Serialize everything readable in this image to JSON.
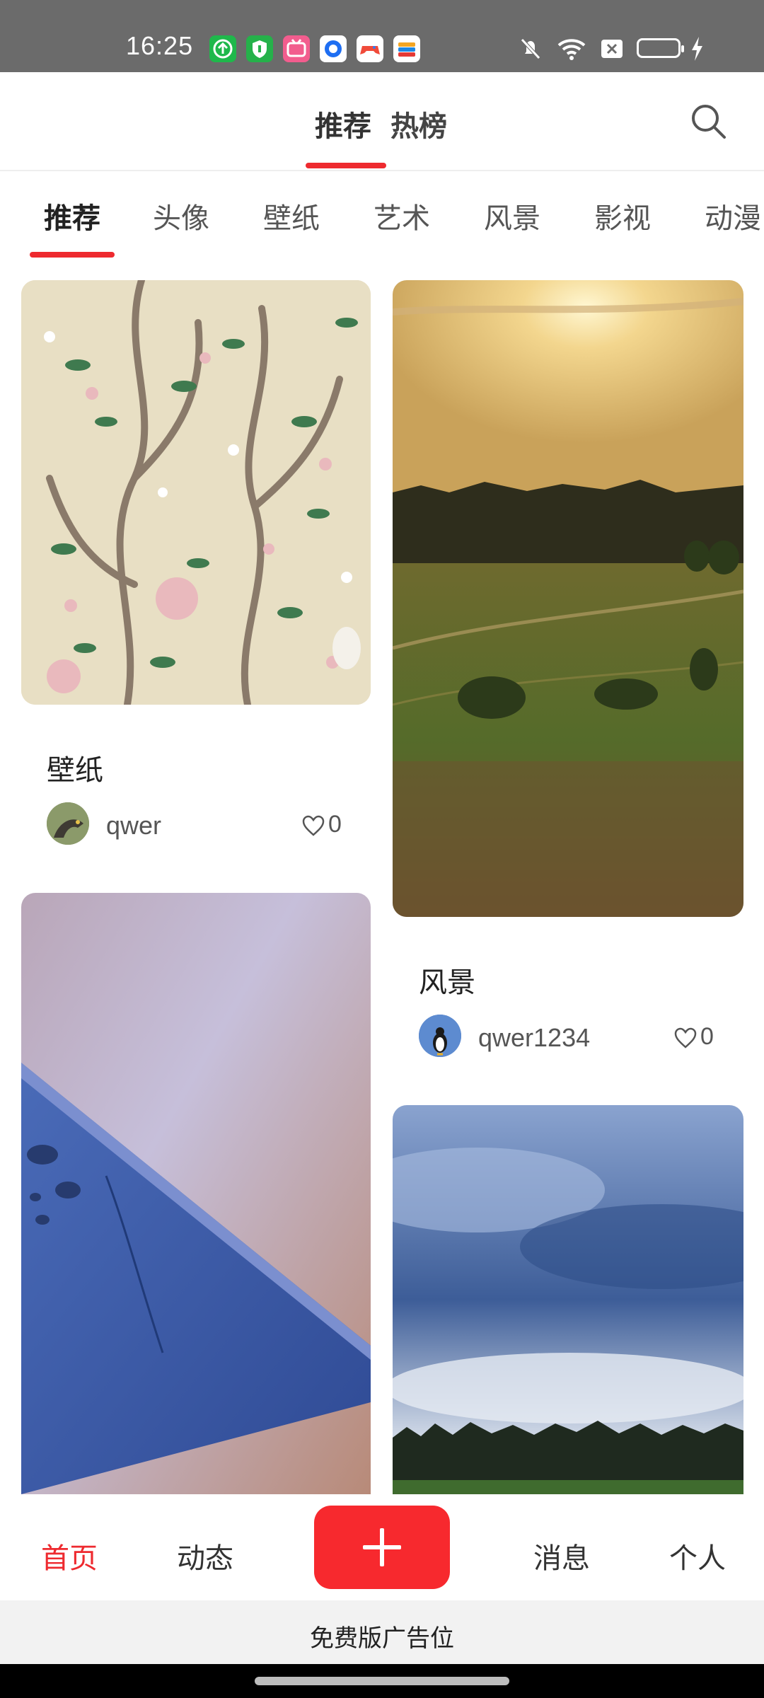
{
  "status_bar": {
    "time": "16:25",
    "app_icons": [
      "green-upload-icon",
      "green-shield-icon",
      "bilibili-icon",
      "blue-circle-app-icon",
      "game-controller-icon",
      "wallet-app-icon"
    ],
    "system_icons": [
      "mute-bell-icon",
      "wifi-icon",
      "sim-off-icon",
      "battery-icon",
      "charging-icon"
    ]
  },
  "header": {
    "tabs": [
      {
        "label": "推荐",
        "active": true
      },
      {
        "label": "热榜",
        "active": false
      }
    ],
    "search_icon": "search-icon"
  },
  "categories": {
    "items": [
      "推荐",
      "头像",
      "壁纸",
      "艺术",
      "风景",
      "影视",
      "动漫"
    ],
    "active_index": 0
  },
  "feed": {
    "left": [
      {
        "title": "壁纸",
        "user": "qwer",
        "likes": "0",
        "image": "floral-chinoiserie-wallpaper"
      },
      {
        "title": "",
        "user": "",
        "likes": "",
        "image": "blue-slate-water-droplets"
      }
    ],
    "right": [
      {
        "title": "风景",
        "user": "qwer1234",
        "likes": "0",
        "image": "sunset-field-landscape"
      },
      {
        "title": "",
        "user": "",
        "likes": "",
        "image": "cloudy-sky-treeline"
      }
    ]
  },
  "bottom_nav": {
    "items": [
      {
        "label": "首页",
        "active": true
      },
      {
        "label": "动态",
        "active": false
      },
      {
        "label": "消息",
        "active": false
      },
      {
        "label": "个人",
        "active": false
      }
    ],
    "fab_icon": "plus-icon"
  },
  "ad_bar": {
    "text": "免费版广告位"
  },
  "colors": {
    "accent": "#ee2a2f",
    "fab": "#f7292e",
    "statusbar": "#6b6b6b"
  }
}
